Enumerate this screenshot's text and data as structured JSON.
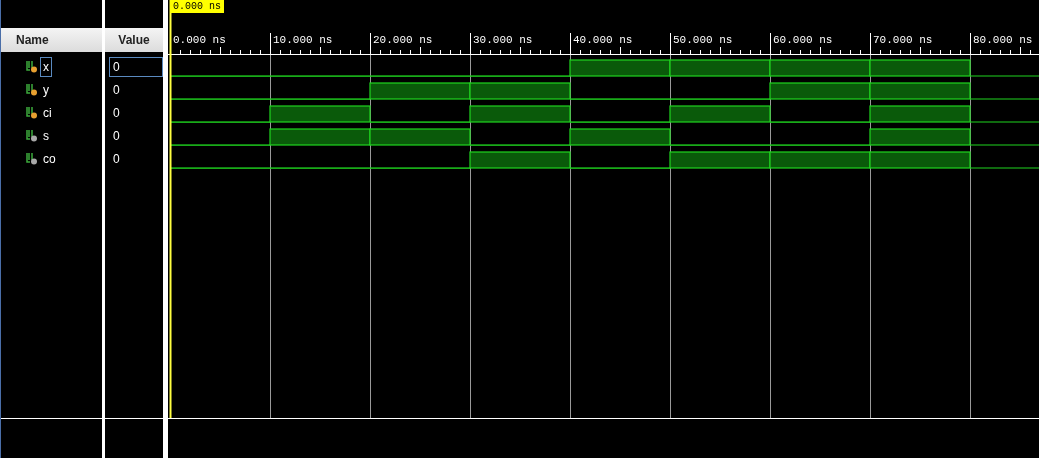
{
  "cursor": {
    "label": "0.000 ns"
  },
  "columns": [
    "Name",
    "Value"
  ],
  "ruler": {
    "labels": [
      "0.000 ns",
      "10.000 ns",
      "20.000 ns",
      "30.000 ns",
      "40.000 ns",
      "50.000 ns",
      "60.000 ns",
      "70.000 ns",
      "80.000 ns"
    ]
  },
  "signals": [
    {
      "name": "x",
      "value": "0",
      "kind": "input",
      "selected": true,
      "high": [
        false,
        false,
        false,
        false,
        true,
        true,
        true,
        true
      ]
    },
    {
      "name": "y",
      "value": "0",
      "kind": "input",
      "selected": false,
      "high": [
        false,
        false,
        true,
        true,
        false,
        false,
        true,
        true
      ]
    },
    {
      "name": "ci",
      "value": "0",
      "kind": "input",
      "selected": false,
      "high": [
        false,
        true,
        false,
        true,
        false,
        true,
        false,
        true
      ]
    },
    {
      "name": "s",
      "value": "0",
      "kind": "output",
      "selected": false,
      "high": [
        false,
        true,
        true,
        false,
        true,
        false,
        false,
        true
      ]
    },
    {
      "name": "co",
      "value": "0",
      "kind": "output",
      "selected": false,
      "high": [
        false,
        false,
        false,
        true,
        false,
        true,
        true,
        true
      ]
    }
  ]
}
